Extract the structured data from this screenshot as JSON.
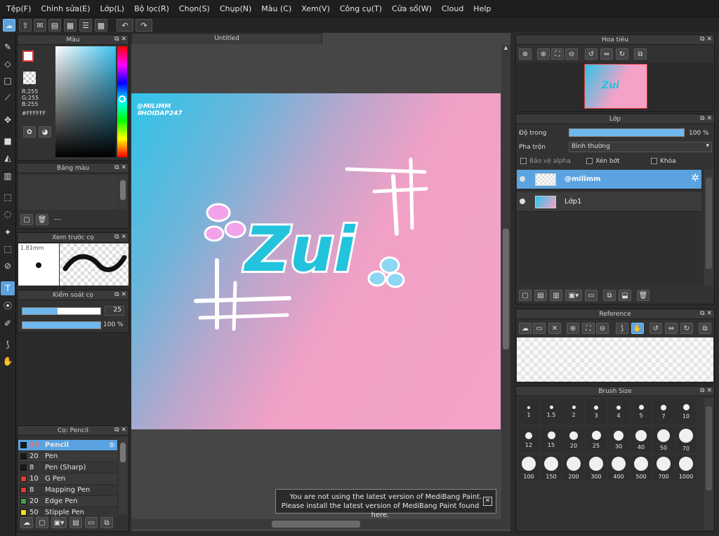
{
  "menu": [
    "Tệp(F)",
    "Chỉnh sửa(E)",
    "Lớp(L)",
    "Bộ lọc(R)",
    "Chọn(S)",
    "Chụp(N)",
    "Màu (C)",
    "Xem(V)",
    "Công cụ(T)",
    "Cửa sổ(W)",
    "Cloud",
    "Help"
  ],
  "color_panel": {
    "title": "Màu",
    "r": "R:255",
    "g": "G:255",
    "b": "B:255",
    "hex": "#FFFFFF"
  },
  "palette_panel": {
    "title": "Bảng màu",
    "footer": "---"
  },
  "brush_preview": {
    "title": "Xem trước cọ",
    "size": "1.81mm"
  },
  "brush_control": {
    "title": "Kiểm soát cọ",
    "size_value": "25",
    "opacity_value": "100 %",
    "size_fraction": 0.45,
    "opacity_fraction": 1.0
  },
  "brush_list": {
    "title": "Cọ: Pencil",
    "items": [
      {
        "size": "25",
        "name": "Pencil",
        "color": "#1a1a1a",
        "selected": true
      },
      {
        "size": "20",
        "name": "Pen",
        "color": "#1a1a1a"
      },
      {
        "size": "8",
        "name": "Pen (Sharp)",
        "color": "#1a1a1a"
      },
      {
        "size": "10",
        "name": "G Pen",
        "color": "#e53935"
      },
      {
        "size": "8",
        "name": "Mapping Pen",
        "color": "#e53935"
      },
      {
        "size": "20",
        "name": "Edge Pen",
        "color": "#43a047"
      },
      {
        "size": "50",
        "name": "Stipple Pen",
        "color": "#f6e01f"
      }
    ]
  },
  "canvas": {
    "tab": "Untitled",
    "watermark_1": "@MILIMM",
    "watermark_2": "#HOIDAP247",
    "logo_text": "Zui"
  },
  "notice": {
    "line1": "You are not using the latest version of MediBang Paint.",
    "line2": "Please install the latest version of MediBang Paint found here."
  },
  "navigator": {
    "title": "Hoa tiêu"
  },
  "layer_panel": {
    "title": "Lớp",
    "opacity_label": "Độ trong",
    "opacity_value": "100 %",
    "opacity_fraction": 1.0,
    "blend_label": "Pha trộn",
    "blend_value": "Bình thường",
    "protect_alpha": "Bảo vệ alpha",
    "clipping": "Xén bớt",
    "lock": "Khóa",
    "layers": [
      {
        "name": "@milimm",
        "selected": true
      },
      {
        "name": "Lớp1",
        "selected": false
      }
    ]
  },
  "reference": {
    "title": "Reference"
  },
  "brush_size": {
    "title": "Brush Size",
    "sizes": [
      "1",
      "1.5",
      "2",
      "3",
      "4",
      "5",
      "7",
      "10",
      "12",
      "15",
      "20",
      "25",
      "30",
      "40",
      "50",
      "70",
      "100",
      "150",
      "200",
      "300",
      "400",
      "500",
      "700",
      "1000"
    ]
  },
  "colors": {
    "accent": "#5aa3e0",
    "gradient_blue": "#2fc4e8",
    "gradient_pink": "#f4a2c8"
  }
}
